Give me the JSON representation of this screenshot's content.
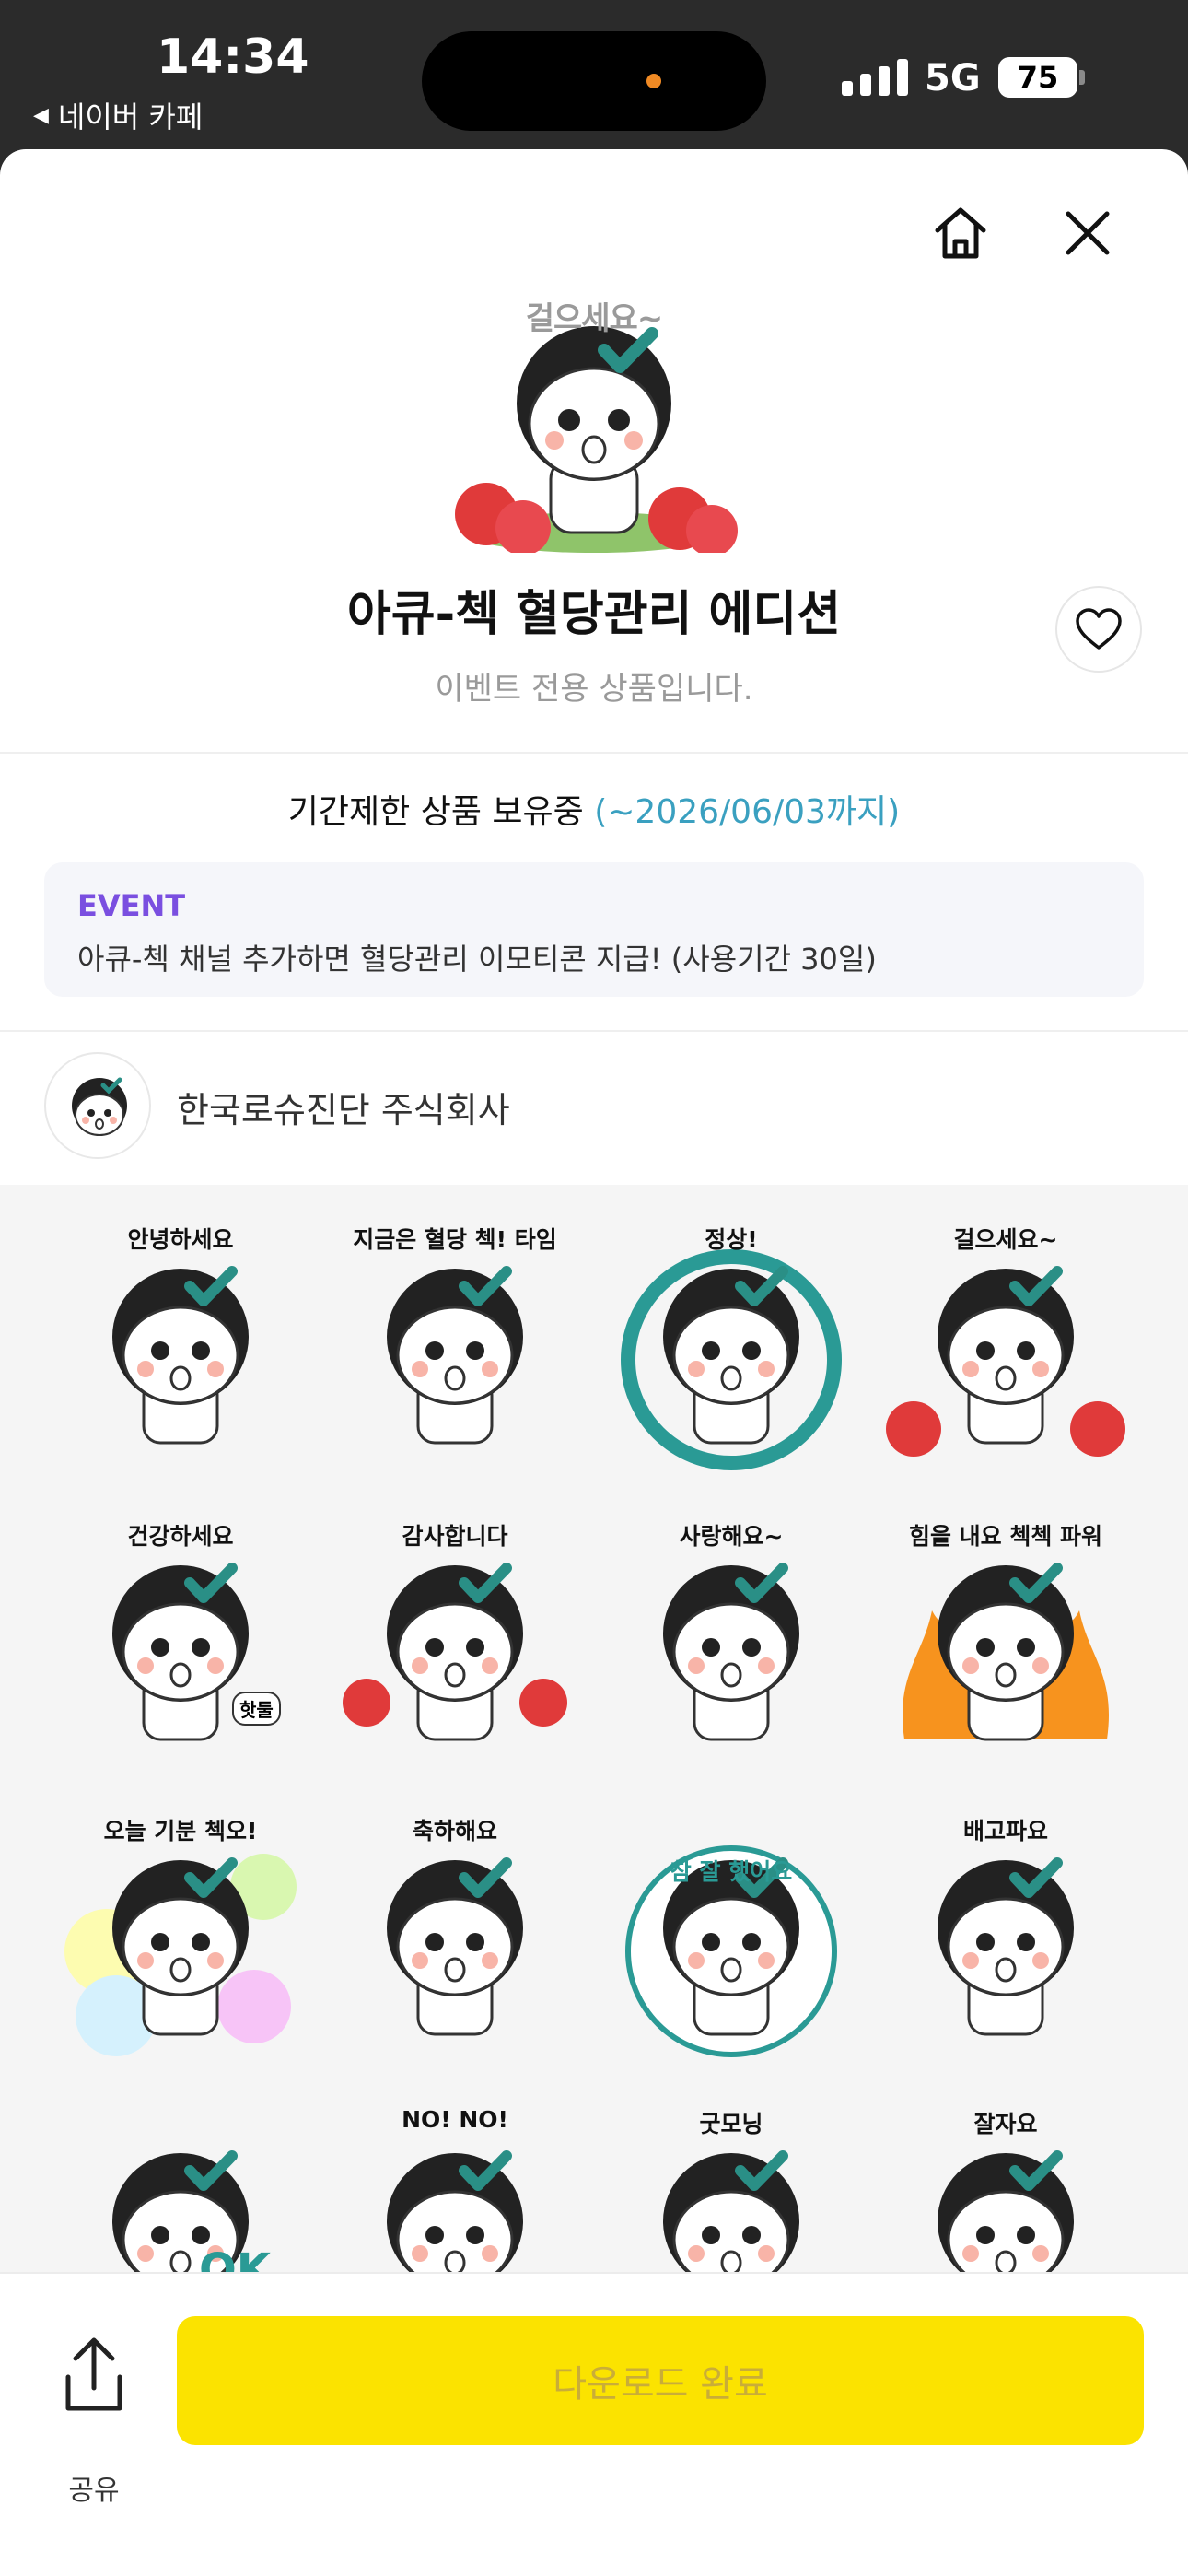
{
  "status_bar": {
    "time": "14:34",
    "back_app": "네이버 카페",
    "network": "5G",
    "battery": "75"
  },
  "product": {
    "hero_caption": "걸으세요~",
    "title": "아큐-첵 혈당관리 에디션",
    "subtitle": "이벤트 전용 상품입니다."
  },
  "limited": {
    "text": "기간제한 상품 보유중",
    "date": "(~2026/06/03까지)"
  },
  "event": {
    "label": "EVENT",
    "text": "아큐-첵 채널 추가하면 혈당관리 이모티콘 지급! (사용기간 30일)"
  },
  "seller": {
    "name": "한국로슈진단 주식회사"
  },
  "stickers": [
    {
      "caption": "안녕하세요"
    },
    {
      "caption": "지금은 혈당 첵! 타임"
    },
    {
      "caption": "정상!"
    },
    {
      "caption": "걸으세요~"
    },
    {
      "caption": "건강하세요"
    },
    {
      "caption": "감사합니다"
    },
    {
      "caption": "사랑해요~"
    },
    {
      "caption": "힘을 내요 첵첵 파워"
    },
    {
      "caption": "오늘 기분 첵오!"
    },
    {
      "caption": "축하해요"
    },
    {
      "caption": "참 잘 했어요"
    },
    {
      "caption": "배고파요"
    },
    {
      "caption": ""
    },
    {
      "caption": "NO! NO!"
    },
    {
      "caption": "굿모닝"
    },
    {
      "caption": "잘자요"
    }
  ],
  "extra_text": {
    "sticker_5_tag": "핫둘",
    "sticker_13_tag": "OK"
  },
  "bottom": {
    "share_label": "공유",
    "download_label": "다운로드 완료"
  },
  "colors": {
    "accent_yellow": "#fbe300",
    "event_purple": "#7a4fe0",
    "date_blue": "#3aa0c0",
    "check_teal": "#2a8f86"
  }
}
